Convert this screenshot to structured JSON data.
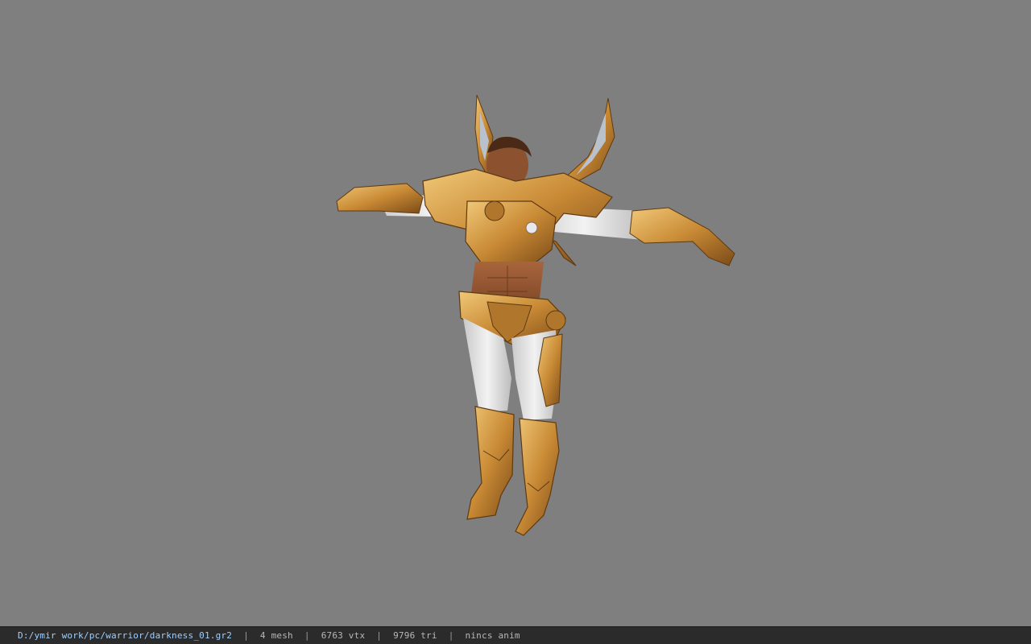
{
  "viewer": {
    "background_color": "#7f7f7f",
    "model_icon": "armored-warrior-model"
  },
  "statusbar": {
    "file_path": "D:/ymir work/pc/warrior/darkness_01.gr2",
    "separator": "|",
    "mesh_count": "4 mesh",
    "vertex_count": "6763 vtx",
    "triangle_count": "9796 tri",
    "anim": "nincs anim"
  }
}
